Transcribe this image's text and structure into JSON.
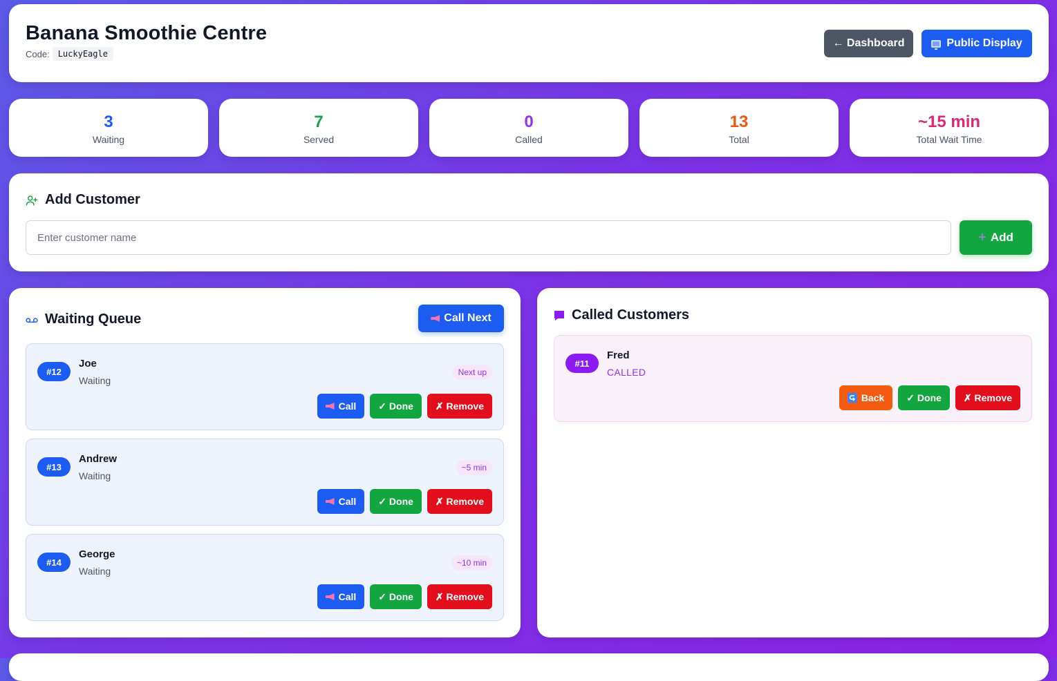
{
  "header": {
    "title": "Banana Smoothie Centre",
    "code_label": "Code:",
    "code_value": "LuckyEagle",
    "dashboard_button": "← Dashboard",
    "public_display_button": "Public Display"
  },
  "stats": [
    {
      "value": "3",
      "label": "Waiting",
      "color": "#1d5cf0"
    },
    {
      "value": "7",
      "label": "Served",
      "color": "#16a34a"
    },
    {
      "value": "0",
      "label": "Called",
      "color": "#9333ea"
    },
    {
      "value": "13",
      "label": "Total",
      "color": "#ea580c"
    },
    {
      "value": "~15 min",
      "label": "Total Wait Time",
      "color": "#db2777"
    }
  ],
  "add_customer": {
    "title": "Add Customer",
    "placeholder": "Enter customer name",
    "value": "",
    "add_button": "Add"
  },
  "waiting_queue": {
    "title": "Waiting Queue",
    "call_next_button": "Call Next",
    "items": [
      {
        "number": "#12",
        "name": "Joe",
        "status": "Waiting",
        "eta": "Next up"
      },
      {
        "number": "#13",
        "name": "Andrew",
        "status": "Waiting",
        "eta": "~5 min"
      },
      {
        "number": "#14",
        "name": "George",
        "status": "Waiting",
        "eta": "~10 min"
      }
    ],
    "actions": {
      "call": "Call",
      "done": "✓ Done",
      "remove": "✗ Remove"
    }
  },
  "called_customers": {
    "title": "Called Customers",
    "items": [
      {
        "number": "#11",
        "name": "Fred",
        "status": "CALLED"
      }
    ],
    "actions": {
      "back": "Back",
      "done": "✓ Done",
      "remove": "✗ Remove"
    }
  },
  "icons": {
    "public_display": "monitor-icon",
    "add_customer": "user-plus-icon",
    "waiting_queue": "voicemail-icon",
    "called_customers": "speech-bubble-icon",
    "call": "megaphone-icon",
    "back": "return-arrow-icon"
  }
}
